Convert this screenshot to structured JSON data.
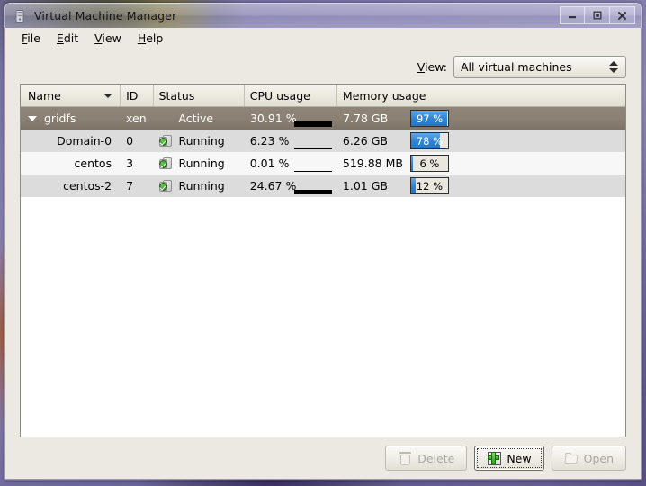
{
  "window": {
    "title": "Virtual Machine Manager",
    "icon": "vm-app-icon",
    "controls": {
      "minimize": "–",
      "maximize": "▣",
      "close": "✕"
    }
  },
  "menubar": {
    "items": [
      {
        "label": "File",
        "mnemonic": "F",
        "rest": "ile"
      },
      {
        "label": "Edit",
        "mnemonic": "E",
        "rest": "dit"
      },
      {
        "label": "View",
        "mnemonic": "V",
        "rest": "iew"
      },
      {
        "label": "Help",
        "mnemonic": "H",
        "rest": "elp"
      }
    ]
  },
  "viewbar": {
    "label_mnemonic": "V",
    "label_rest": "iew",
    "label_colon": ":",
    "combo_value": "All virtual machines",
    "combo_options": [
      "All virtual machines"
    ]
  },
  "table": {
    "columns": [
      {
        "key": "name",
        "label": "Name",
        "sorted": true
      },
      {
        "key": "id",
        "label": "ID",
        "sorted": false
      },
      {
        "key": "status",
        "label": "Status",
        "sorted": false
      },
      {
        "key": "cpu",
        "label": "CPU usage",
        "sorted": false
      },
      {
        "key": "memory",
        "label": "Memory usage",
        "sorted": false
      }
    ],
    "rows": [
      {
        "name": "gridfs",
        "id": "xen",
        "status": "Active",
        "status_icon": null,
        "cpu": "30.91 %",
        "cpu_value": 30.91,
        "memory": "7.78 GB",
        "memory_pct_label": "97 %",
        "memory_pct": 97,
        "level": "parent",
        "selected": true,
        "expanded": true
      },
      {
        "name": "Domain-0",
        "id": "0",
        "status": "Running",
        "status_icon": "vm-running-icon",
        "cpu": "6.23 %",
        "cpu_value": 6.23,
        "memory": "6.26 GB",
        "memory_pct_label": "78 %",
        "memory_pct": 78,
        "level": "child",
        "selected": false
      },
      {
        "name": "centos",
        "id": "3",
        "status": "Running",
        "status_icon": "vm-running-icon",
        "cpu": "0.01 %",
        "cpu_value": 0.01,
        "memory": "519.88 MB",
        "memory_pct_label": "6 %",
        "memory_pct": 6,
        "level": "child",
        "selected": false
      },
      {
        "name": "centos-2",
        "id": "7",
        "status": "Running",
        "status_icon": "vm-running-icon",
        "cpu": "24.67 %",
        "cpu_value": 24.67,
        "memory": "1.01 GB",
        "memory_pct_label": "12 %",
        "memory_pct": 12,
        "level": "child",
        "selected": false
      }
    ]
  },
  "buttons": [
    {
      "key": "delete",
      "label": "Delete",
      "mnemonic": "D",
      "rest": "elete",
      "icon": "trash-icon",
      "disabled": true,
      "focused": false
    },
    {
      "key": "new",
      "label": "New",
      "mnemonic": "N",
      "rest": "ew",
      "icon": "new-icon",
      "disabled": false,
      "focused": true
    },
    {
      "key": "open",
      "label": "Open",
      "mnemonic": "O",
      "rest": "pen",
      "icon": "folder-icon",
      "disabled": true,
      "focused": false
    }
  ],
  "colors": {
    "selection": "#8a8073",
    "progress_fill": "#2f86d6",
    "window_bg": "#ece9e2",
    "list_bg": "#ffffff",
    "row_odd": "#dcdcdc",
    "row_even": "#f7f7f7"
  }
}
